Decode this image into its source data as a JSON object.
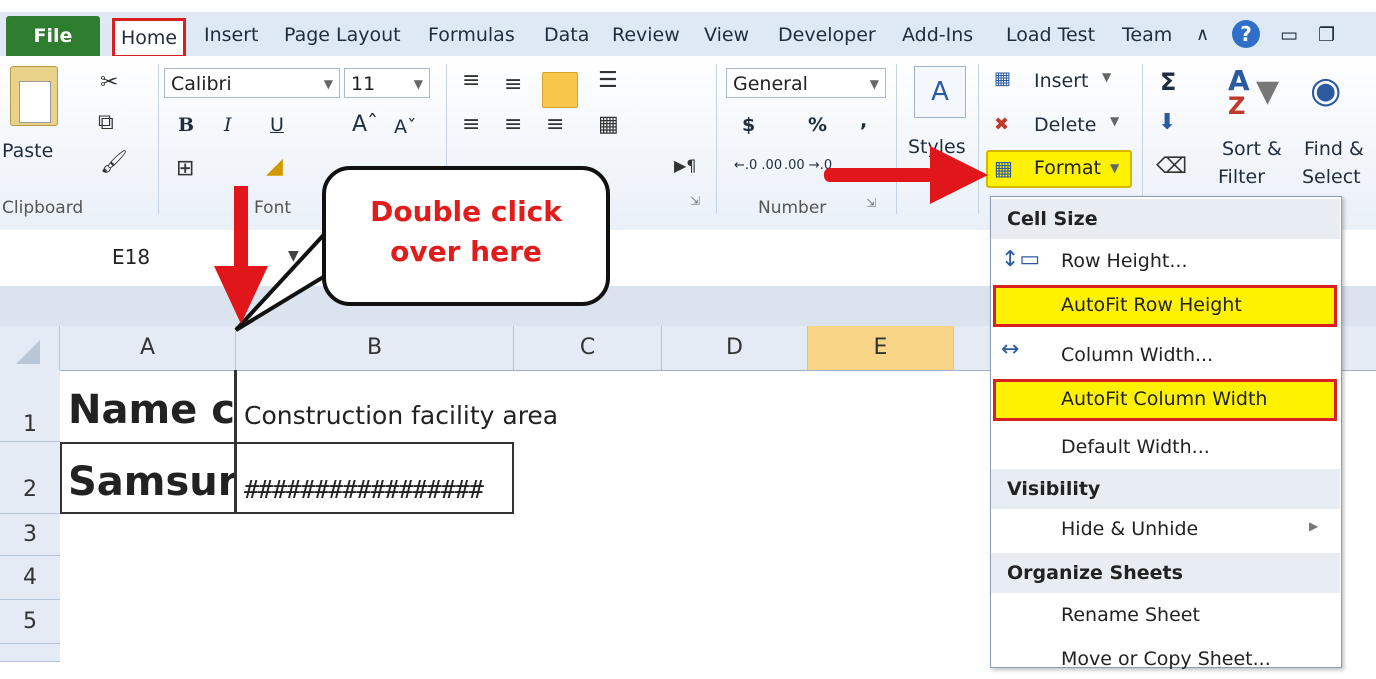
{
  "tabs": [
    "File",
    "Home",
    "Insert",
    "Page Layout",
    "Formulas",
    "Data",
    "Review",
    "View",
    "Developer",
    "Add-Ins",
    "Load Test",
    "Team"
  ],
  "ribbon": {
    "clipboard": {
      "paste": "Paste",
      "label": "Clipboard"
    },
    "font": {
      "name": "Calibri",
      "size": "11",
      "bold": "B",
      "italic": "I",
      "underline": "U",
      "grow": "Aˆ",
      "shrink": "Aˇ",
      "label": "Font"
    },
    "number": {
      "format": "General",
      "currency": "$",
      "percent": "%",
      "comma": ",",
      "inc_dec": "←.0 .00",
      "dec_dec": ".00 →.0",
      "label": "Number"
    },
    "styles": {
      "label": "Styles"
    },
    "cells": {
      "insert": "Insert",
      "delete": "Delete",
      "format": "Format"
    },
    "editing": {
      "sum": "Σ",
      "sort": "Sort &",
      "filter": "Filter",
      "find": "Find &",
      "select": "Select"
    }
  },
  "namebox": "E18",
  "callout": {
    "line1": "Double click",
    "line2": "over here"
  },
  "columns": [
    "A",
    "B",
    "C",
    "D",
    "E"
  ],
  "rows": [
    "1",
    "2",
    "3",
    "4",
    "5"
  ],
  "cells": {
    "A1": "Name c",
    "B1": "Construction facility area",
    "A2": "Samsur",
    "B2": "#################"
  },
  "menu": {
    "cell_size": "Cell Size",
    "row_height": "Row Height...",
    "autofit_row": "AutoFit Row Height",
    "column_width": "Column Width...",
    "autofit_column": "AutoFit Column Width",
    "default_width": "Default Width...",
    "visibility": "Visibility",
    "hide_unhide": "Hide & Unhide",
    "organize": "Organize Sheets",
    "rename": "Rename Sheet",
    "move_copy": "Move or Copy Sheet..."
  },
  "colors": {
    "highlight": "#fff200",
    "annotation": "#d91f1f",
    "file_tab": "#2f7d2f"
  }
}
